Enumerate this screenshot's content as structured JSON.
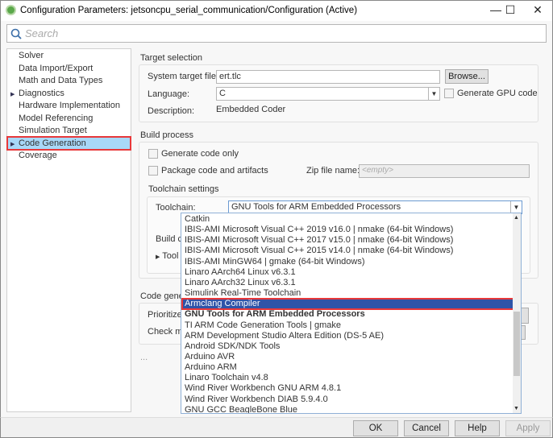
{
  "window": {
    "title": "Configuration Parameters: jetsoncpu_serial_communication/Configuration (Active)",
    "minimize": "—",
    "maximize": "☐",
    "close": "✕"
  },
  "search": {
    "placeholder": "Search",
    "icon": "search-icon"
  },
  "nav": {
    "items": [
      {
        "label": "Solver",
        "expandable": false
      },
      {
        "label": "Data Import/Export",
        "expandable": false
      },
      {
        "label": "Math and Data Types",
        "expandable": false
      },
      {
        "label": "Diagnostics",
        "expandable": true
      },
      {
        "label": "Hardware Implementation",
        "expandable": false
      },
      {
        "label": "Model Referencing",
        "expandable": false
      },
      {
        "label": "Simulation Target",
        "expandable": false
      },
      {
        "label": "Code Generation",
        "expandable": true,
        "selected": true
      },
      {
        "label": "Coverage",
        "expandable": false
      }
    ]
  },
  "target": {
    "heading": "Target selection",
    "stf_label": "System target file:",
    "stf_value": "ert.tlc",
    "browse": "Browse...",
    "lang_label": "Language:",
    "lang_value": "C",
    "gpu_label": "Generate GPU code",
    "desc_label": "Description:",
    "desc_value": "Embedded Coder"
  },
  "build": {
    "heading": "Build process",
    "gen_only": "Generate code only",
    "package": "Package code and artifacts",
    "zip_label": "Zip file name:",
    "zip_placeholder": "<empty>",
    "tc_heading": "Toolchain settings",
    "tc_label": "Toolchain:",
    "tc_value": "GNU Tools for ARM Embedded Processors",
    "build_cfg_partial": "Build c",
    "tool_partial": "Tool"
  },
  "codegen": {
    "heading_partial": "Code gene",
    "prioritize_partial": "Prioritize",
    "check_partial": "Check m",
    "ellipsis": "..."
  },
  "dropdown": {
    "options": [
      "Catkin",
      "IBIS-AMI Microsoft Visual C++ 2019 v16.0 | nmake (64-bit Windows)",
      "IBIS-AMI Microsoft Visual C++ 2017 v15.0 | nmake (64-bit Windows)",
      "IBIS-AMI Microsoft Visual C++ 2015 v14.0 | nmake (64-bit Windows)",
      "IBIS-AMI MinGW64 | gmake (64-bit Windows)",
      "Linaro AArch64 Linux v6.3.1",
      "Linaro AArch32 Linux v6.3.1",
      "Simulink Real-Time Toolchain",
      "Armclang Compiler",
      "GNU Tools for ARM Embedded Processors",
      "TI ARM Code Generation Tools | gmake",
      "ARM Development Studio Altera Edition (DS-5 AE)",
      "Android SDK/NDK Tools",
      "Arduino AVR",
      "Arduino ARM",
      "Linaro Toolchain v4.8",
      "Wind River Workbench GNU ARM 4.8.1",
      "Wind River Workbench DIAB 5.9.4.0",
      "GNU GCC BeagleBone Blue"
    ],
    "highlighted": "Armclang Compiler",
    "current": "GNU Tools for ARM Embedded Processors"
  },
  "footer": {
    "ok": "OK",
    "cancel": "Cancel",
    "help": "Help",
    "apply": "Apply",
    "apply_enabled": false
  },
  "colors": {
    "selection": "#2f54a8",
    "nav_selection": "#a8d8f8",
    "highlight_border": "#e8383a"
  }
}
